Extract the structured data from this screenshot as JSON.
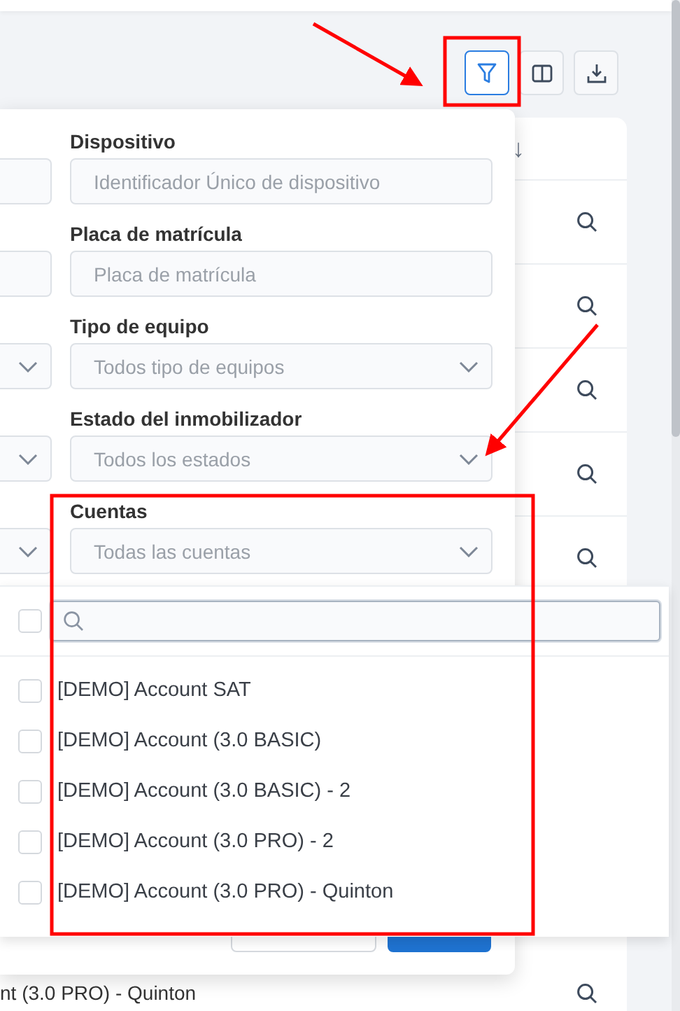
{
  "toolbar": {
    "buttons": [
      {
        "kind": "filter",
        "selected": true
      },
      {
        "kind": "columns",
        "selected": false
      },
      {
        "kind": "download",
        "selected": false
      }
    ]
  },
  "table": {
    "sort_indicator": "↓",
    "rows": [
      {
        "kind": "view"
      },
      {
        "kind": "view"
      },
      {
        "kind": "view"
      },
      {
        "kind": "view"
      },
      {
        "kind": "view"
      }
    ],
    "last_row": {
      "kind": "view",
      "cell": "nt (3.0 PRO) - Quinton"
    }
  },
  "filter_panel": {
    "left_fields": [
      {
        "kind": "input"
      },
      {
        "kind": "input"
      },
      {
        "kind": "select"
      },
      {
        "kind": "select"
      },
      {
        "kind": "select"
      }
    ],
    "fields": [
      {
        "label": "Dispositivo",
        "kind": "input",
        "placeholder": "Identificador Único de dispositivo"
      },
      {
        "label": "Placa de matrícula",
        "kind": "input",
        "placeholder": "Placa de matrícula"
      },
      {
        "label": "Tipo de equipo",
        "kind": "select",
        "placeholder": "Todos tipo de equipos"
      },
      {
        "label": "Estado del inmobilizador",
        "kind": "select",
        "placeholder": "Todos los estados"
      },
      {
        "label": "Cuentas",
        "kind": "select",
        "placeholder": "Todas las cuentas"
      }
    ],
    "buttons": [
      {
        "kind": "secondary"
      },
      {
        "kind": "primary"
      }
    ]
  },
  "accounts_dropdown": {
    "select_all_checked": false,
    "items": [
      {
        "label": "[DEMO] Account SAT",
        "checked": false
      },
      {
        "label": "[DEMO] Account (3.0 BASIC)",
        "checked": false
      },
      {
        "label": "[DEMO] Account (3.0 BASIC) - 2",
        "checked": false
      },
      {
        "label": "[DEMO] Account (3.0 PRO) - 2",
        "checked": false
      },
      {
        "label": "[DEMO] Account (3.0 PRO) - Quinton",
        "checked": false
      }
    ]
  }
}
